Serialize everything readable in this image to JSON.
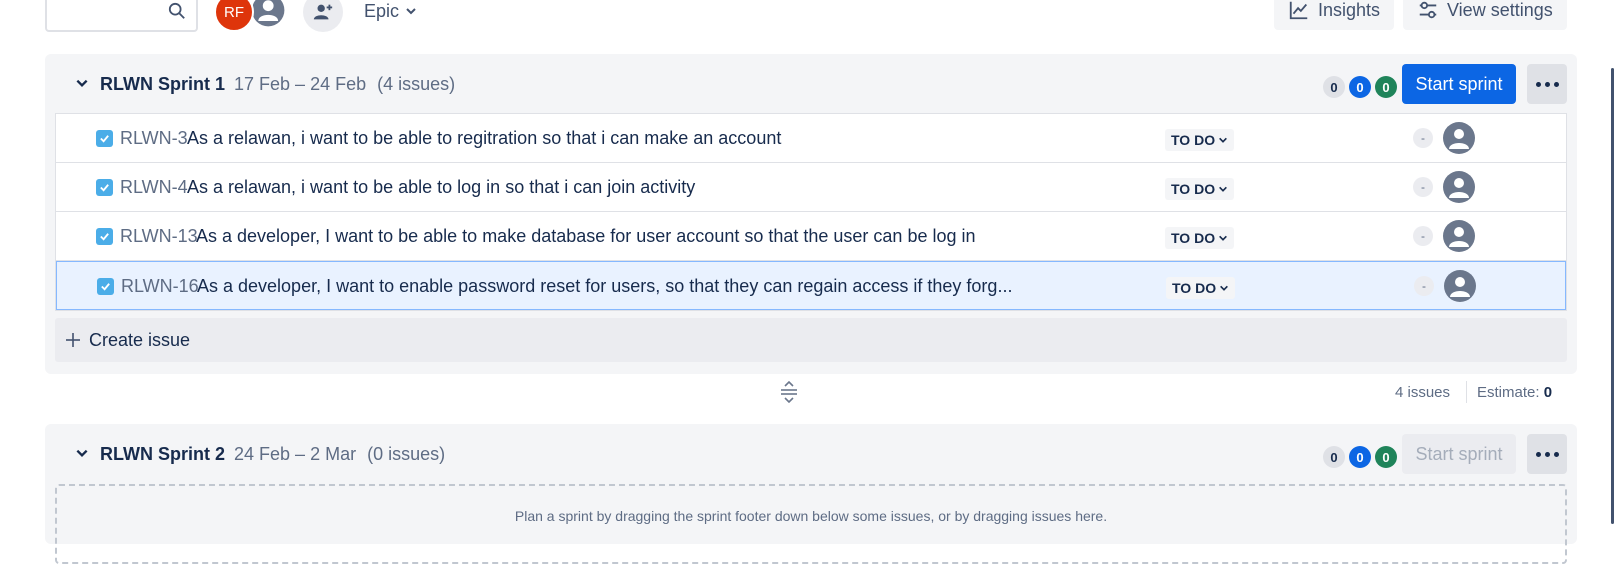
{
  "toolbar": {
    "search_placeholder": "",
    "avatar_initials": "RF",
    "epic_label": "Epic",
    "insights_label": "Insights",
    "view_settings_label": "View settings"
  },
  "sprints": [
    {
      "name": "RLWN Sprint 1",
      "dates": "17 Feb – 24 Feb",
      "issue_count": "(4 issues)",
      "counts": {
        "todo": "0",
        "in_progress": "0",
        "done": "0"
      },
      "start_label": "Start sprint",
      "start_enabled": true,
      "issues": [
        {
          "key": "RLWN-3",
          "summary": "As a relawan, i want to be able to regitration so that i can make an account",
          "status": "TO DO",
          "estimate": "-"
        },
        {
          "key": "RLWN-4",
          "summary": "As a relawan, i want to be able to log in so that i can join activity",
          "status": "TO DO",
          "estimate": "-"
        },
        {
          "key": "RLWN-13",
          "summary": "As a developer, I want to be able to make database for user account so that the user can be log in",
          "status": "TO DO",
          "estimate": "-"
        },
        {
          "key": "RLWN-16",
          "summary": "As a developer, I want to enable password reset for users, so that they can regain access if they forg...",
          "status": "TO DO",
          "estimate": "-"
        }
      ],
      "create_issue_label": "Create issue",
      "footer": {
        "issues_text": "4 issues",
        "estimate_label": "Estimate:",
        "estimate_value": "0"
      }
    },
    {
      "name": "RLWN Sprint 2",
      "dates": "24 Feb – 2 Mar",
      "issue_count": "(0 issues)",
      "counts": {
        "todo": "0",
        "in_progress": "0",
        "done": "0"
      },
      "start_label": "Start sprint",
      "start_enabled": false,
      "empty_text": "Plan a sprint by dragging the sprint footer down below some issues, or by dragging issues here."
    }
  ],
  "colors": {
    "primary": "#0c66e4",
    "done_green": "#1f845a",
    "avatar_red": "#de350b",
    "story_blue": "#4bade8"
  },
  "icons": [
    "search-icon",
    "add-people-icon",
    "chevron-down-icon",
    "insights-icon",
    "settings-sliders-icon",
    "more-icon",
    "checkbox-task-icon",
    "user-avatar-icon",
    "plus-icon",
    "drag-handle-icon"
  ]
}
